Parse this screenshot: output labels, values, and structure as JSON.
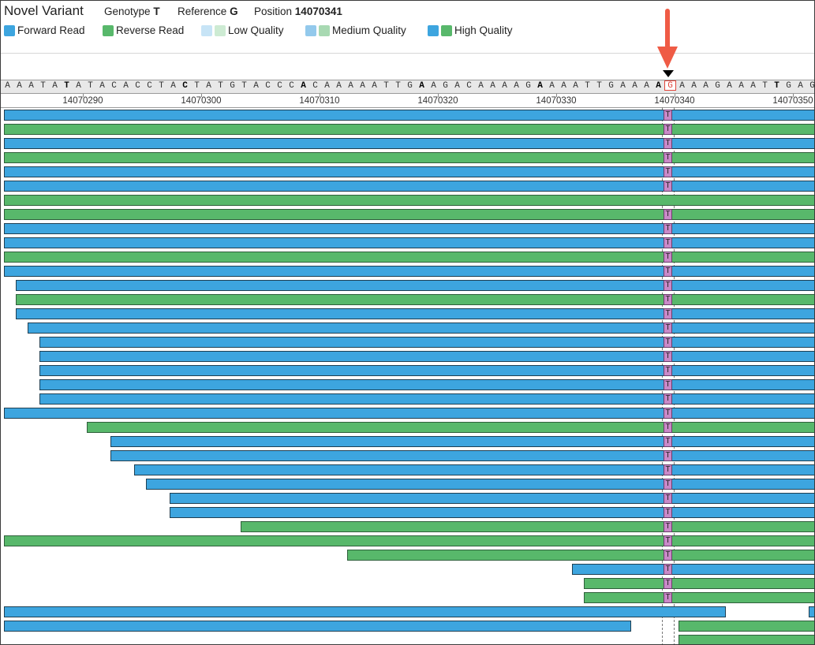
{
  "header": {
    "title": "Novel Variant",
    "genotype_label": "Genotype",
    "genotype_value": "T",
    "reference_label": "Reference",
    "reference_value": "G",
    "position_label": "Position",
    "position_value": "14070341"
  },
  "legend": {
    "forward": "Forward Read",
    "reverse": "Reverse Read",
    "low": "Low Quality",
    "medium": "Medium Quality",
    "high": "High Quality"
  },
  "colors": {
    "forward_high": "#3da5df",
    "reverse_high": "#58b86b",
    "forward_low": "#c7e4f6",
    "reverse_low": "#cdebd3",
    "forward_medium": "#93c9ec",
    "reverse_medium": "#a8d9b2",
    "variant": "#c989c8",
    "arrow": "#ef5b45"
  },
  "reference_sequence": [
    "A",
    "A",
    "A",
    "T",
    "A",
    "T",
    "A",
    "T",
    "A",
    "C",
    "A",
    "C",
    "C",
    "T",
    "A",
    "C",
    "T",
    "A",
    "T",
    "G",
    "T",
    "A",
    "C",
    "C",
    "C",
    "A",
    "C",
    "A",
    "A",
    "A",
    "A",
    "A",
    "T",
    "T",
    "G",
    "A",
    "A",
    "G",
    "A",
    "C",
    "A",
    "A",
    "A",
    "A",
    "G",
    "A",
    "A",
    "A",
    "A",
    "T",
    "T",
    "G",
    "A",
    "A",
    "A",
    "A",
    "G",
    "A",
    "A",
    "A",
    "G",
    "A",
    "A",
    "A",
    "T",
    "T",
    "G",
    "A",
    "G"
  ],
  "bold_bases": [
    5,
    15,
    25,
    35,
    45,
    55,
    65
  ],
  "reference_index": 56,
  "ruler_labels": [
    "14070290",
    "14070300",
    "14070310",
    "14070320",
    "14070330",
    "14070340",
    "14070350"
  ],
  "variant_base": "T",
  "reads": [
    {
      "strand": "fwd",
      "start": 0,
      "end": 69,
      "variant": true
    },
    {
      "strand": "rev",
      "start": 0,
      "end": 69,
      "variant": true
    },
    {
      "strand": "fwd",
      "start": 0,
      "end": 69,
      "variant": true
    },
    {
      "strand": "rev",
      "start": 0,
      "end": 69,
      "variant": true
    },
    {
      "strand": "fwd",
      "start": 0,
      "end": 69,
      "variant": true
    },
    {
      "strand": "fwd",
      "start": 0,
      "end": 69,
      "variant": true
    },
    {
      "strand": "rev",
      "start": 0,
      "end": 69,
      "variant": false
    },
    {
      "strand": "rev",
      "start": 0,
      "end": 69,
      "variant": true
    },
    {
      "strand": "fwd",
      "start": 0,
      "end": 69,
      "variant": true
    },
    {
      "strand": "fwd",
      "start": 0,
      "end": 69,
      "variant": true
    },
    {
      "strand": "rev",
      "start": 0,
      "end": 69,
      "variant": true
    },
    {
      "strand": "fwd",
      "start": 0,
      "end": 69,
      "variant": true
    },
    {
      "strand": "fwd",
      "start": 1,
      "end": 69,
      "variant": true
    },
    {
      "strand": "rev",
      "start": 1,
      "end": 69,
      "variant": true
    },
    {
      "strand": "fwd",
      "start": 1,
      "end": 69,
      "variant": true
    },
    {
      "strand": "fwd",
      "start": 2,
      "end": 69,
      "variant": true
    },
    {
      "strand": "fwd",
      "start": 3,
      "end": 69,
      "variant": true
    },
    {
      "strand": "fwd",
      "start": 3,
      "end": 69,
      "variant": true
    },
    {
      "strand": "fwd",
      "start": 3,
      "end": 69,
      "variant": true
    },
    {
      "strand": "fwd",
      "start": 3,
      "end": 69,
      "variant": true
    },
    {
      "strand": "fwd",
      "start": 3,
      "end": 69,
      "variant": true
    },
    {
      "strand": "fwd",
      "start": 0,
      "end": 69,
      "variant": true
    },
    {
      "strand": "rev",
      "start": 7,
      "end": 69,
      "variant": true
    },
    {
      "strand": "fwd",
      "start": 9,
      "end": 69,
      "variant": true
    },
    {
      "strand": "fwd",
      "start": 9,
      "end": 69,
      "variant": true
    },
    {
      "strand": "fwd",
      "start": 11,
      "end": 69,
      "variant": true
    },
    {
      "strand": "fwd",
      "start": 12,
      "end": 69,
      "variant": true
    },
    {
      "strand": "fwd",
      "start": 14,
      "end": 69,
      "variant": true
    },
    {
      "strand": "fwd",
      "start": 14,
      "end": 69,
      "variant": true
    },
    {
      "strand": "rev",
      "start": 20,
      "end": 69,
      "variant": true
    },
    {
      "strand": "rev",
      "start": 0,
      "end": 69,
      "variant": true
    },
    {
      "strand": "rev",
      "start": 29,
      "end": 69,
      "variant": true
    },
    {
      "strand": "fwd",
      "start": 48,
      "end": 69,
      "variant": true
    },
    {
      "strand": "rev",
      "start": 49,
      "end": 69,
      "variant": true
    },
    {
      "strand": "rev",
      "start": 49,
      "end": 69,
      "variant": true
    },
    {
      "strand": "fwd",
      "start": 0,
      "end": 61,
      "variant": false
    },
    {
      "strand": "fwd",
      "start": 68,
      "end": 69,
      "variant": false
    },
    {
      "strand": "fwd",
      "start": 0,
      "end": 53,
      "variant": false
    },
    {
      "strand": "rev",
      "start": 57,
      "end": 69,
      "variant": false
    },
    {
      "strand": "rev",
      "start": 57,
      "end": 69,
      "variant": false
    }
  ],
  "read_rows": [
    0,
    1,
    2,
    3,
    4,
    5,
    6,
    7,
    8,
    9,
    10,
    11,
    12,
    13,
    14,
    15,
    16,
    17,
    18,
    19,
    20,
    21,
    22,
    23,
    24,
    25,
    26,
    27,
    28,
    29,
    30,
    31,
    32,
    33,
    34,
    35,
    35,
    36,
    36,
    37
  ]
}
